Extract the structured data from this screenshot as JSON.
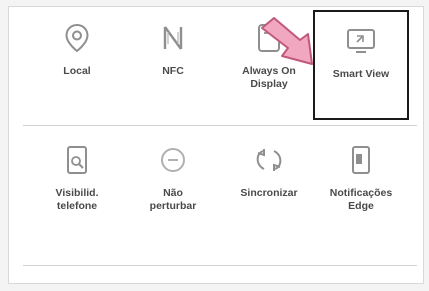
{
  "quick_settings": {
    "row1": [
      {
        "label": "Local",
        "icon": "location-icon"
      },
      {
        "label": "NFC",
        "icon": "nfc-icon"
      },
      {
        "label": "Always On\nDisplay",
        "icon": "always-on-display-icon"
      },
      {
        "label": "Smart View",
        "icon": "smart-view-icon",
        "selected": true
      }
    ],
    "row2": [
      {
        "label": "Visibilid.\ntelefone",
        "icon": "phone-visibility-icon"
      },
      {
        "label": "Não\nperturbar",
        "icon": "do-not-disturb-icon"
      },
      {
        "label": "Sincronizar",
        "icon": "sync-icon"
      },
      {
        "label": "Notificações\nEdge",
        "icon": "edge-notifications-icon"
      }
    ]
  },
  "colors": {
    "icon": "#8f8f8f",
    "arrow_fill": "#f2a7c0",
    "arrow_stroke": "#c0587e",
    "highlight": "#1a1a1a"
  }
}
